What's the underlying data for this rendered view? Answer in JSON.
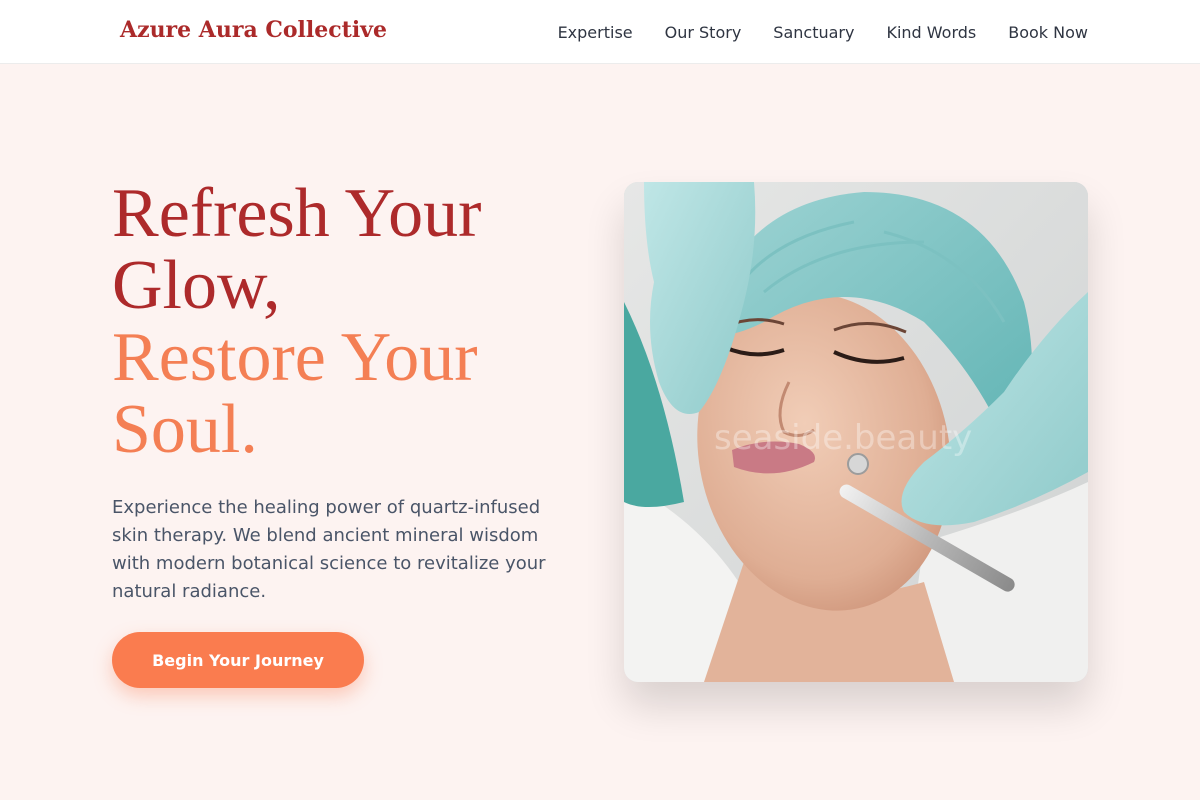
{
  "header": {
    "brand": "Azure Aura Collective",
    "nav": [
      "Expertise",
      "Our Story",
      "Sanctuary",
      "Kind Words",
      "Book Now"
    ]
  },
  "hero": {
    "headline_line1": "Refresh Your",
    "headline_line2": "Glow,",
    "headline_line3": "Restore Your",
    "headline_line4": "Soul.",
    "description": "Experience the healing power of quartz-infused skin therapy. We blend ancient mineral wisdom with modern botanical science to revitalize your natural radiance.",
    "cta_label": "Begin Your Journey"
  },
  "image": {
    "watermark": "seaside.beauty"
  },
  "colors": {
    "brand": "#ab2a2a",
    "accent": "#fa7c4f",
    "background": "#fdf3f1"
  }
}
